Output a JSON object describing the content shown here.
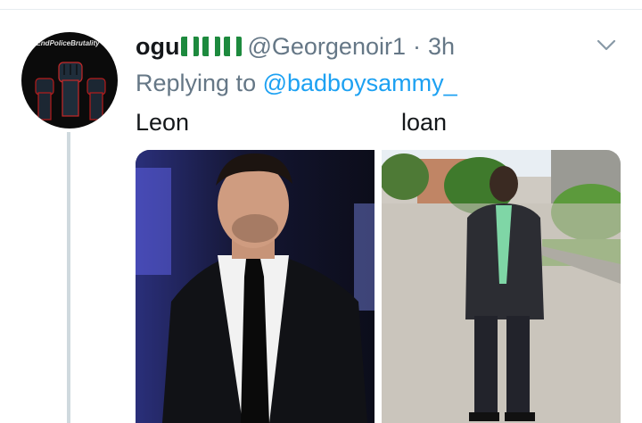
{
  "tweet": {
    "avatar_tag": {
      "hash": "#",
      "text": "EndPoliceBrutality"
    },
    "display_name": "ogu",
    "flags_count": 3,
    "handle": "@Georgenoir1",
    "separator": "·",
    "time": "3h",
    "reply_prefix": "Replying to ",
    "reply_user": "@badboysammy_",
    "captions": {
      "left": "Leon",
      "right": "loan"
    }
  },
  "colors": {
    "brand_link": "#1da1f2",
    "muted": "#657786",
    "text": "#14171a",
    "flag_green": "#1d8a3e"
  },
  "icons": {
    "more": "chevron-down-icon"
  }
}
